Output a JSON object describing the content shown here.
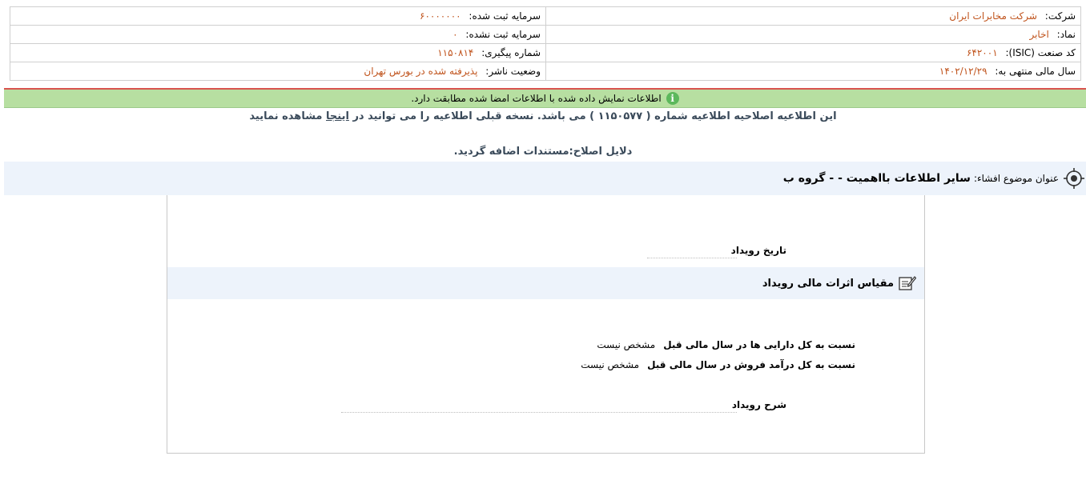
{
  "header": {
    "company_label": "شرکت:",
    "company_value": "شرکت مخابرات ایران",
    "symbol_label": "نماد:",
    "symbol_value": "اخابر",
    "isic_label": "کد صنعت (ISIC):",
    "isic_value": "۶۴۲۰۰۱",
    "fiscal_label": "سال مالی منتهی به:",
    "fiscal_value": "۱۴۰۲/۱۲/۲۹",
    "reg_capital_label": "سرمایه ثبت شده:",
    "reg_capital_value": "۶۰۰۰۰۰۰۰",
    "unreg_capital_label": "سرمایه ثبت نشده:",
    "unreg_capital_value": "۰",
    "tracking_label": "شماره پیگیری:",
    "tracking_value": "۱۱۵۰۸۱۴",
    "publisher_status_label": "وضعیت ناشر:",
    "publisher_status_value": "پذیرفته شده در بورس تهران"
  },
  "banner": {
    "message": "اطلاعات نمایش داده شده با اطلاعات امضا شده مطابقت دارد."
  },
  "correction": {
    "text_before": "این اطلاعیه اصلاحیه اطلاعیه شماره ( ۱۱۵۰۵۷۷ ) می باشد. نسخه قبلی اطلاعیه را می توانید در ",
    "link_text": "اینجا",
    "text_after": " مشاهده نمایید",
    "reasons": "دلایل اصلاح:مستندات اضافه گردید."
  },
  "subject": {
    "label": "عنوان موضوع افشاء:",
    "value": "سایر اطلاعات بااهمیت - - گروه ب"
  },
  "panel": {
    "event_date_label": "تاریخ رویداد",
    "measure_title": "مقیاس اثرات مالی رویداد",
    "ratios": [
      {
        "label": "نسبت به کل دارایی ها در سال مالی قبل",
        "value": "مشخص نیست"
      },
      {
        "label": "نسبت به کل درآمد فروش در سال مالی قبل",
        "value": "مشخص نیست"
      }
    ],
    "description_label": "شرح رویداد"
  },
  "colors": {
    "value_orange": "#c0531c",
    "banner_green": "#b7dfa1",
    "red_line": "#d9534f",
    "section_bg": "#edf3fb"
  }
}
